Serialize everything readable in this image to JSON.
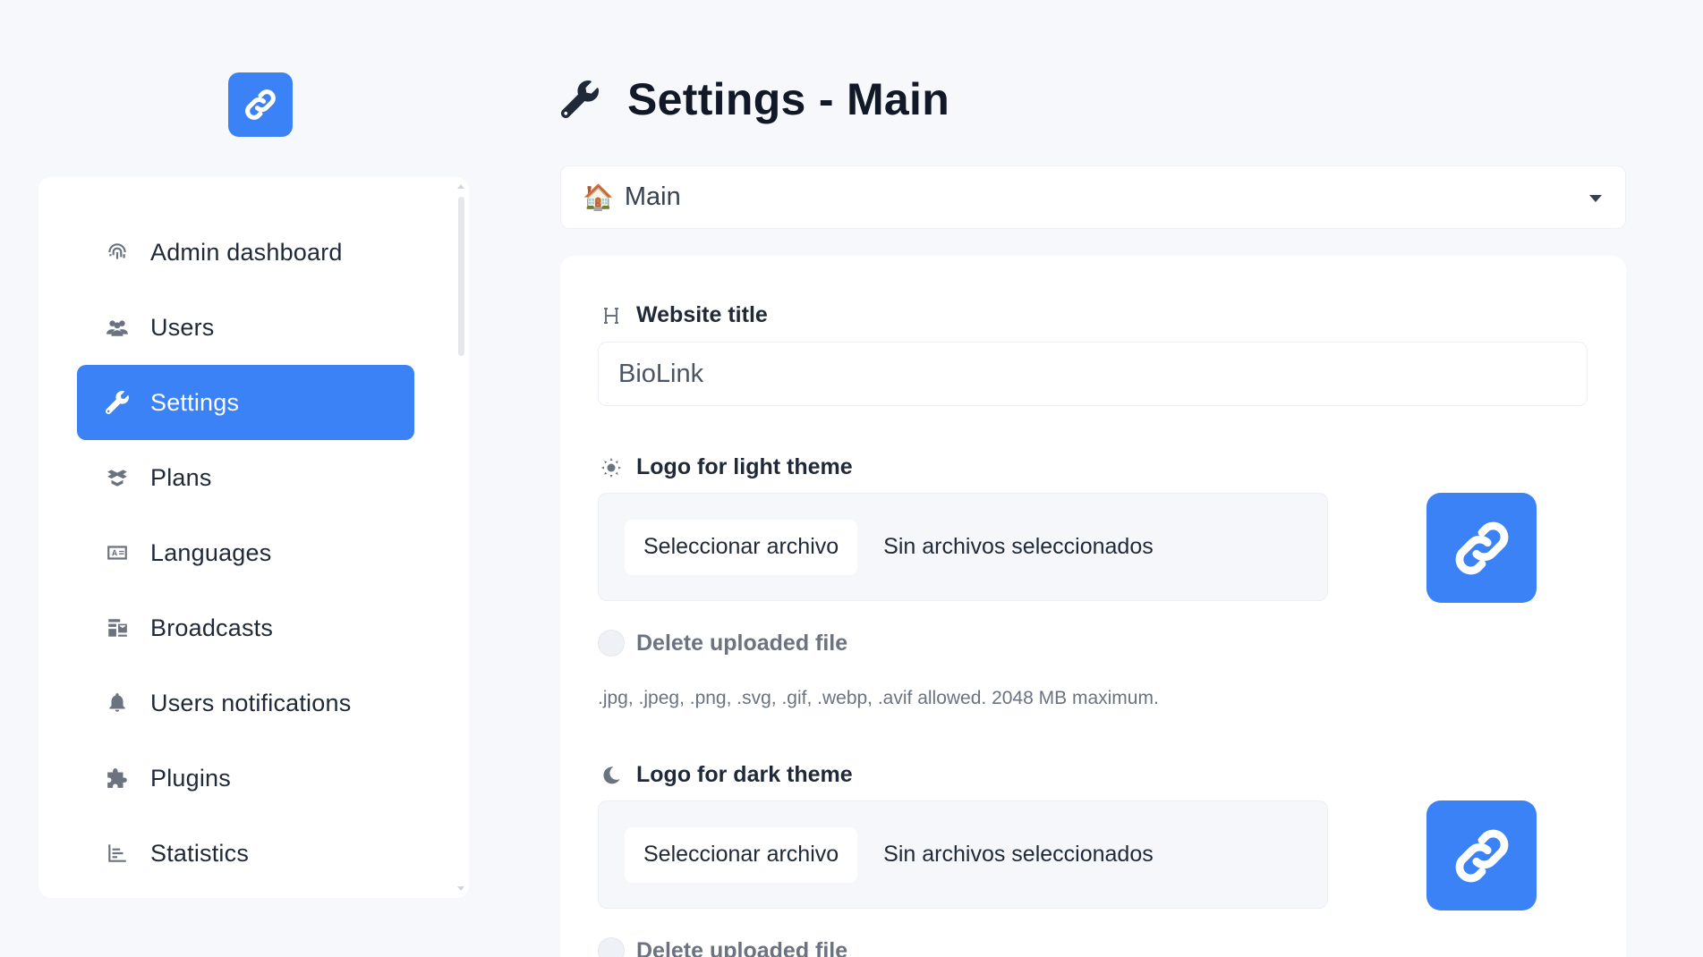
{
  "sidebar": {
    "items": [
      {
        "label": "Admin dashboard",
        "icon": "fingerprint-icon"
      },
      {
        "label": "Users",
        "icon": "users-icon"
      },
      {
        "label": "Settings",
        "icon": "wrench-icon",
        "active": true
      },
      {
        "label": "Plans",
        "icon": "box-open-icon"
      },
      {
        "label": "Languages",
        "icon": "language-icon"
      },
      {
        "label": "Broadcasts",
        "icon": "mail-bulk-icon"
      },
      {
        "label": "Users notifications",
        "icon": "bell-icon"
      },
      {
        "label": "Plugins",
        "icon": "puzzle-icon"
      },
      {
        "label": "Statistics",
        "icon": "chart-bar-icon"
      }
    ]
  },
  "header": {
    "title": "Settings - Main",
    "icon": "wrench-icon"
  },
  "section_select": {
    "icon": "house-icon",
    "value": "Main"
  },
  "form": {
    "website_title": {
      "label": "Website title",
      "icon": "heading-icon",
      "value": "BioLink"
    },
    "logo_light": {
      "label": "Logo for light theme",
      "icon": "sun-icon",
      "button": "Seleccionar archivo",
      "status": "Sin archivos seleccionados",
      "delete_label": "Delete uploaded file",
      "help": ".jpg, .jpeg, .png, .svg, .gif, .webp, .avif allowed. 2048 MB maximum."
    },
    "logo_dark": {
      "label": "Logo for dark theme",
      "icon": "moon-icon",
      "button": "Seleccionar archivo",
      "status": "Sin archivos seleccionados",
      "delete_label": "Delete uploaded file"
    }
  },
  "colors": {
    "accent": "#3b82f6",
    "background": "#f6f8fb",
    "card": "#ffffff",
    "muted_icon": "#6b7280"
  }
}
